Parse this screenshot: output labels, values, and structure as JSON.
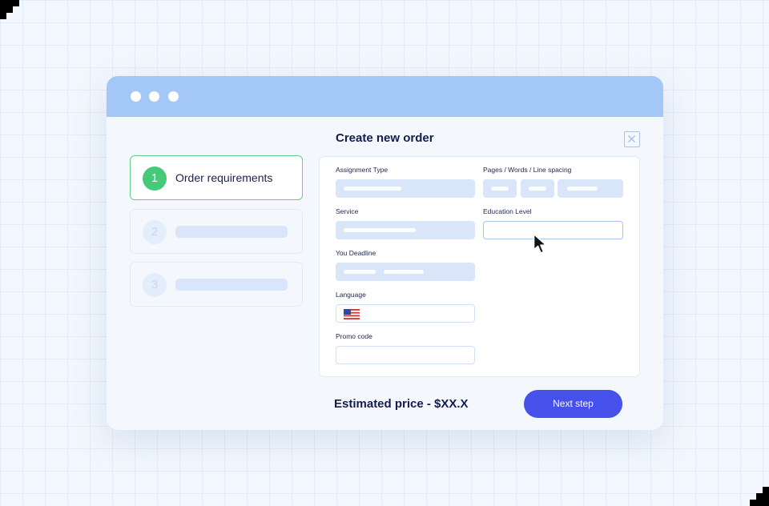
{
  "dialog": {
    "title": "Create new order",
    "close_icon": "close-icon"
  },
  "steps": [
    {
      "number": "1",
      "label": "Order requirements",
      "state": "active"
    },
    {
      "number": "2",
      "label": "",
      "state": "inactive"
    },
    {
      "number": "3",
      "label": "",
      "state": "inactive"
    }
  ],
  "form": {
    "assignment_type_label": "Assignment Type",
    "pages_label": "Pages / Words / Line spacing",
    "service_label": "Service",
    "education_level_label": "Education Level",
    "deadline_label": "You Deadline",
    "language_label": "Language",
    "language_flag_icon": "us-flag-icon",
    "promo_code_label": "Promo code"
  },
  "footer": {
    "price_text": "Estimated price - $XX.X",
    "next_button_label": "Next step"
  },
  "colors": {
    "titlebar": "#a3c8f7",
    "accent_green": "#45c97a",
    "primary_button": "#4650ea",
    "heading_text": "#141c4f",
    "placeholder_fill": "#d9e6fa"
  }
}
